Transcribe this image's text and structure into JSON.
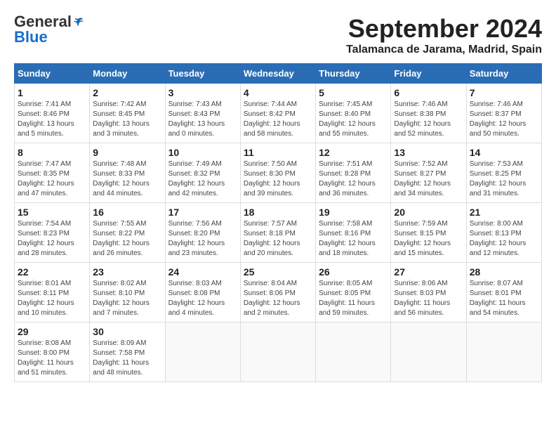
{
  "header": {
    "logo_general": "General",
    "logo_blue": "Blue",
    "month_year": "September 2024",
    "location": "Talamanca de Jarama, Madrid, Spain"
  },
  "weekdays": [
    "Sunday",
    "Monday",
    "Tuesday",
    "Wednesday",
    "Thursday",
    "Friday",
    "Saturday"
  ],
  "weeks": [
    [
      {
        "day": "1",
        "info": "Sunrise: 7:41 AM\nSunset: 8:46 PM\nDaylight: 13 hours\nand 5 minutes."
      },
      {
        "day": "2",
        "info": "Sunrise: 7:42 AM\nSunset: 8:45 PM\nDaylight: 13 hours\nand 3 minutes."
      },
      {
        "day": "3",
        "info": "Sunrise: 7:43 AM\nSunset: 8:43 PM\nDaylight: 13 hours\nand 0 minutes."
      },
      {
        "day": "4",
        "info": "Sunrise: 7:44 AM\nSunset: 8:42 PM\nDaylight: 12 hours\nand 58 minutes."
      },
      {
        "day": "5",
        "info": "Sunrise: 7:45 AM\nSunset: 8:40 PM\nDaylight: 12 hours\nand 55 minutes."
      },
      {
        "day": "6",
        "info": "Sunrise: 7:46 AM\nSunset: 8:38 PM\nDaylight: 12 hours\nand 52 minutes."
      },
      {
        "day": "7",
        "info": "Sunrise: 7:46 AM\nSunset: 8:37 PM\nDaylight: 12 hours\nand 50 minutes."
      }
    ],
    [
      {
        "day": "8",
        "info": "Sunrise: 7:47 AM\nSunset: 8:35 PM\nDaylight: 12 hours\nand 47 minutes."
      },
      {
        "day": "9",
        "info": "Sunrise: 7:48 AM\nSunset: 8:33 PM\nDaylight: 12 hours\nand 44 minutes."
      },
      {
        "day": "10",
        "info": "Sunrise: 7:49 AM\nSunset: 8:32 PM\nDaylight: 12 hours\nand 42 minutes."
      },
      {
        "day": "11",
        "info": "Sunrise: 7:50 AM\nSunset: 8:30 PM\nDaylight: 12 hours\nand 39 minutes."
      },
      {
        "day": "12",
        "info": "Sunrise: 7:51 AM\nSunset: 8:28 PM\nDaylight: 12 hours\nand 36 minutes."
      },
      {
        "day": "13",
        "info": "Sunrise: 7:52 AM\nSunset: 8:27 PM\nDaylight: 12 hours\nand 34 minutes."
      },
      {
        "day": "14",
        "info": "Sunrise: 7:53 AM\nSunset: 8:25 PM\nDaylight: 12 hours\nand 31 minutes."
      }
    ],
    [
      {
        "day": "15",
        "info": "Sunrise: 7:54 AM\nSunset: 8:23 PM\nDaylight: 12 hours\nand 28 minutes."
      },
      {
        "day": "16",
        "info": "Sunrise: 7:55 AM\nSunset: 8:22 PM\nDaylight: 12 hours\nand 26 minutes."
      },
      {
        "day": "17",
        "info": "Sunrise: 7:56 AM\nSunset: 8:20 PM\nDaylight: 12 hours\nand 23 minutes."
      },
      {
        "day": "18",
        "info": "Sunrise: 7:57 AM\nSunset: 8:18 PM\nDaylight: 12 hours\nand 20 minutes."
      },
      {
        "day": "19",
        "info": "Sunrise: 7:58 AM\nSunset: 8:16 PM\nDaylight: 12 hours\nand 18 minutes."
      },
      {
        "day": "20",
        "info": "Sunrise: 7:59 AM\nSunset: 8:15 PM\nDaylight: 12 hours\nand 15 minutes."
      },
      {
        "day": "21",
        "info": "Sunrise: 8:00 AM\nSunset: 8:13 PM\nDaylight: 12 hours\nand 12 minutes."
      }
    ],
    [
      {
        "day": "22",
        "info": "Sunrise: 8:01 AM\nSunset: 8:11 PM\nDaylight: 12 hours\nand 10 minutes."
      },
      {
        "day": "23",
        "info": "Sunrise: 8:02 AM\nSunset: 8:10 PM\nDaylight: 12 hours\nand 7 minutes."
      },
      {
        "day": "24",
        "info": "Sunrise: 8:03 AM\nSunset: 8:08 PM\nDaylight: 12 hours\nand 4 minutes."
      },
      {
        "day": "25",
        "info": "Sunrise: 8:04 AM\nSunset: 8:06 PM\nDaylight: 12 hours\nand 2 minutes."
      },
      {
        "day": "26",
        "info": "Sunrise: 8:05 AM\nSunset: 8:05 PM\nDaylight: 11 hours\nand 59 minutes."
      },
      {
        "day": "27",
        "info": "Sunrise: 8:06 AM\nSunset: 8:03 PM\nDaylight: 11 hours\nand 56 minutes."
      },
      {
        "day": "28",
        "info": "Sunrise: 8:07 AM\nSunset: 8:01 PM\nDaylight: 11 hours\nand 54 minutes."
      }
    ],
    [
      {
        "day": "29",
        "info": "Sunrise: 8:08 AM\nSunset: 8:00 PM\nDaylight: 11 hours\nand 51 minutes."
      },
      {
        "day": "30",
        "info": "Sunrise: 8:09 AM\nSunset: 7:58 PM\nDaylight: 11 hours\nand 48 minutes."
      },
      null,
      null,
      null,
      null,
      null
    ]
  ]
}
